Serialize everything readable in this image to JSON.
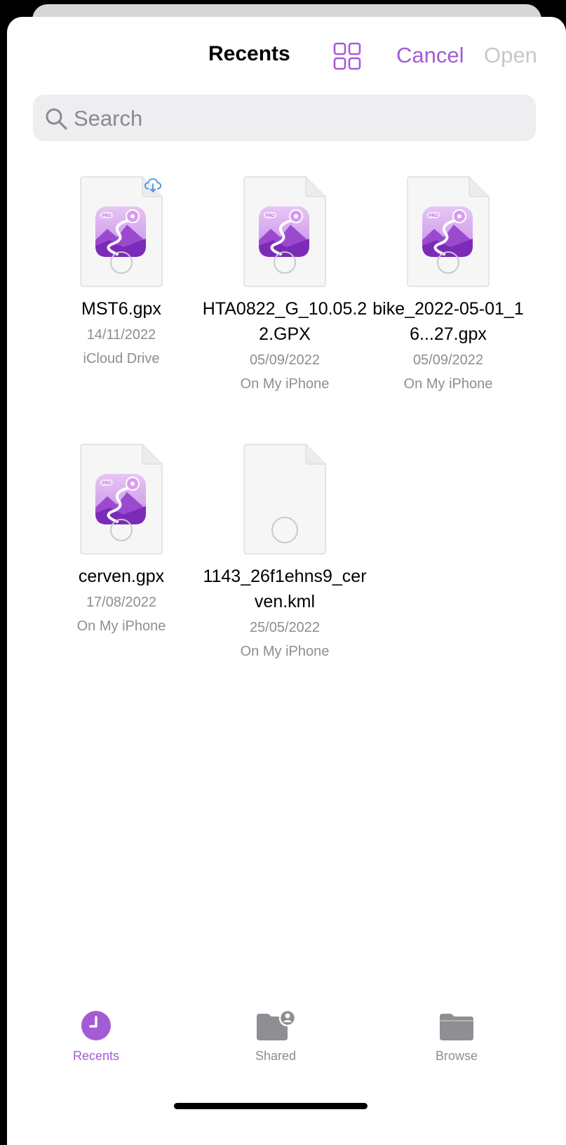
{
  "nav": {
    "title": "Recents",
    "grid_icon": "grid-view-icon",
    "cancel_label": "Cancel",
    "open_label": "Open"
  },
  "search": {
    "placeholder": "Search",
    "icon": "search-icon"
  },
  "files": [
    {
      "name": "MST6.gpx",
      "date": "14/11/2022",
      "location": "iCloud Drive",
      "thumbnail": "app-icon",
      "cloud": true
    },
    {
      "name": "HTA0822_G_10.05.22.GPX",
      "date": "05/09/2022",
      "location": "On My iPhone",
      "thumbnail": "app-icon",
      "cloud": false
    },
    {
      "name": "bike_2022-05-01_16...27.gpx",
      "date": "05/09/2022",
      "location": "On My iPhone",
      "thumbnail": "app-icon",
      "cloud": false
    },
    {
      "name": "cerven.gpx",
      "date": "17/08/2022",
      "location": "On My iPhone",
      "thumbnail": "app-icon",
      "cloud": false
    },
    {
      "name": "1143_26f1ehns9_cerven.kml",
      "date": "25/05/2022",
      "location": "On My iPhone",
      "thumbnail": "blank-document",
      "cloud": false
    }
  ],
  "tabs": [
    {
      "label": "Recents",
      "icon": "clock-icon",
      "active": true
    },
    {
      "label": "Shared",
      "icon": "shared-folder-icon",
      "active": false
    },
    {
      "label": "Browse",
      "icon": "folder-icon",
      "active": false
    }
  ],
  "colors": {
    "accent": "#a45bd6",
    "disabled": "#c7c7cc",
    "secondary_text": "#8e8e93"
  }
}
